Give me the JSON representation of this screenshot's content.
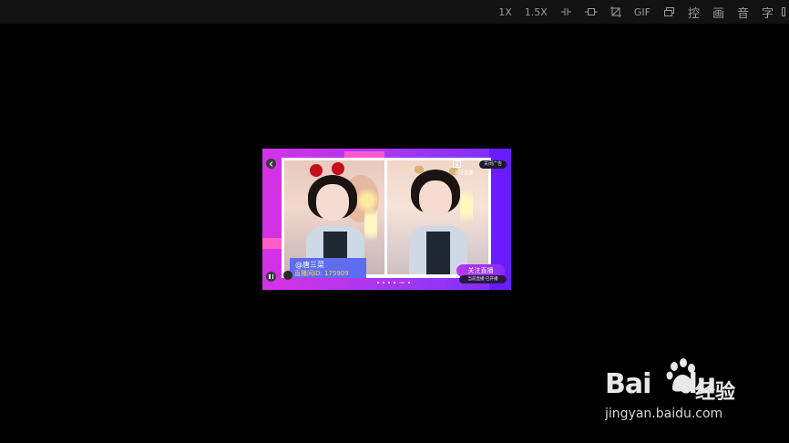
{
  "toolbar": {
    "speed_1x": "1X",
    "speed_15x": "1.5X",
    "gif": "GIF",
    "control": "控",
    "picture": "画",
    "audio": "音",
    "subtitle": "字"
  },
  "video": {
    "streamer_name": "@唐三菜",
    "room_id": "直播间ID: 175909",
    "follow_label": "关注直播",
    "bottom_strip_text": "当前直播·已开播",
    "top_caption": "关注直播",
    "ad_pill": "关闭广告"
  },
  "watermark": {
    "logo_bai": "Bai",
    "logo_du": "du",
    "logo_cn": "经验",
    "url": "jingyan.baidu.com"
  },
  "colors": {
    "background": "#000000",
    "toolbar_bg": "#121212",
    "video_gradient_left": "#d632e6",
    "video_gradient_right": "#7a2bff",
    "nameplate_bg": "#5e6cf0",
    "room_id_color": "#ffd34a"
  }
}
